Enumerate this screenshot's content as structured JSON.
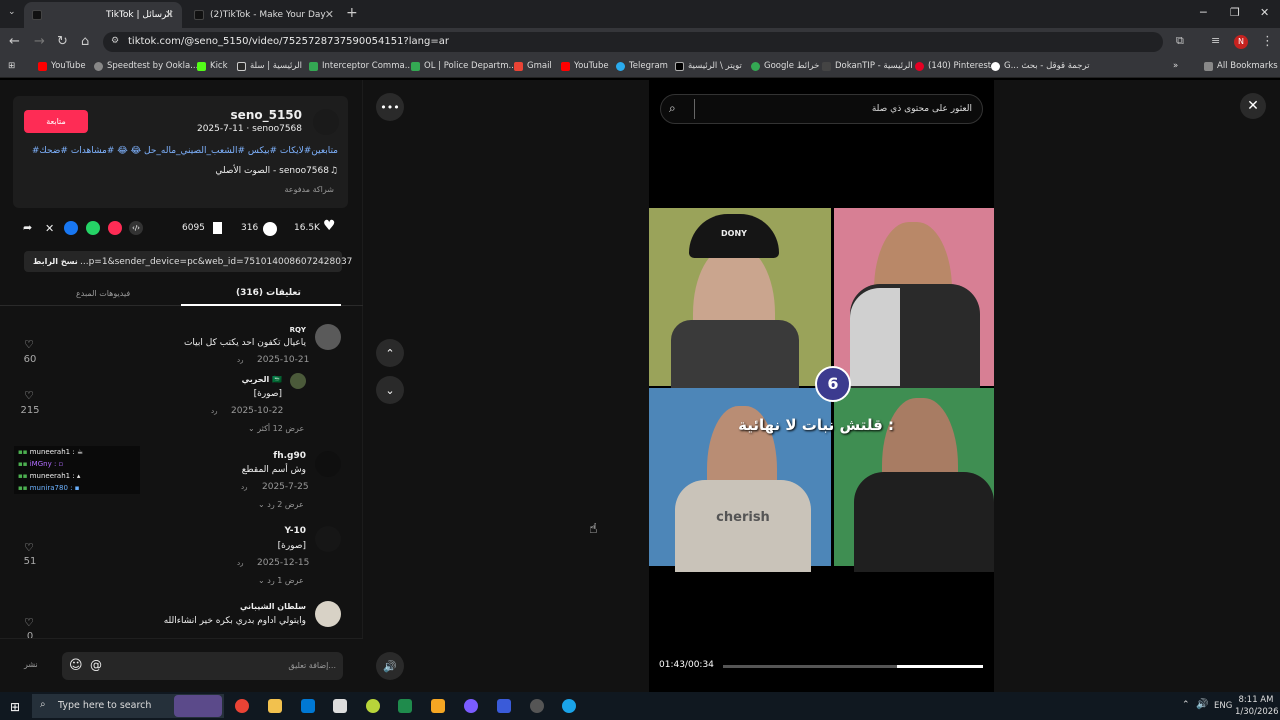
{
  "browser": {
    "tabs": [
      {
        "title": "TikTok | الرسائل"
      },
      {
        "title": "(2)TikTok - Make Your Day"
      }
    ],
    "url": "tiktok.com/@seno_5150/video/7525728737590054151?lang=ar",
    "bookmarks": [
      "YouTube",
      "Speedtest by Ookla...",
      "Kick",
      "الرئيسية | سلة",
      "Interceptor Comma...",
      "OL | Police Departm...",
      "Gmail",
      "YouTube",
      "Telegram",
      "تويتر \\ الرئيسية",
      "Google خرائط",
      "DokanTIP - الرئيسية",
      "(140) Pinterest",
      "G... ترجمة قوقل - بحث"
    ],
    "all_bookmarks": "All Bookmarks",
    "profile_initial": "N"
  },
  "post": {
    "follow_label": "متابعة",
    "username": "seno_5150",
    "meta": "2025-7-11 · senoo7568",
    "hashtags": "#متابعين#لايكات #بيكس #الشعب_الصيني_ماله_حل 😂 😂 #مشاهدات #ضحك",
    "sound": "الصوت الأصلي - senoo7568",
    "sponsored": "شراكة مدفوعة",
    "likes": "16.5K",
    "comments": "316",
    "saves": "6095",
    "copy_link": "نسخ الرابط",
    "link_text": "...p=1&sender_device=pc&web_id=7510140086072428037"
  },
  "tabs_panel": {
    "comments_tab": "(316) تعليقات",
    "creator_tab": "فيديوهات المبدع"
  },
  "comments": [
    {
      "user": "RQY",
      "text": "ياعيال تكفون احد يكتب كل ابيات",
      "date": "2025-10-21",
      "reply": "رد",
      "likes": "60"
    },
    {
      "user": "الحربي 🇸🇦",
      "text": "[صورة]",
      "date": "2025-10-22",
      "reply": "رد",
      "likes": "215",
      "more": "عرض 12 أكثر"
    },
    {
      "user": "fh.g90",
      "text": "وش أسم المقطع",
      "date": "2025-7-25",
      "reply": "رد",
      "more": "عرض 2 رد"
    },
    {
      "user": "Y-10",
      "text": "[صورة]",
      "date": "2025-12-15",
      "reply": "رد",
      "likes": "51",
      "more": "عرض 1 رد"
    },
    {
      "user": "سلطان الشيباني",
      "text": "وايتولي اداوم بدري بكره خير انشاءالله",
      "likes": "0"
    }
  ],
  "overlay_chat": [
    {
      "name": "muneerah1 :"
    },
    {
      "name": "iMGny :"
    },
    {
      "name": "muneerah1 :"
    },
    {
      "name": "munira780 :"
    }
  ],
  "input": {
    "placeholder": "إضافة تعليق...",
    "post_label": "نشر"
  },
  "video": {
    "search_placeholder": "العثور على محتوى ذي صلة",
    "caption": "قلتش نبات لا نهائية :",
    "cap_text": "DONY",
    "shirt_text": "cherish",
    "time": "01:43/00:34",
    "progress": 0.33
  },
  "taskbar": {
    "search_placeholder": "Type here to search",
    "lang": "ENG",
    "time": "8:11 AM",
    "date": "1/30/2026"
  }
}
